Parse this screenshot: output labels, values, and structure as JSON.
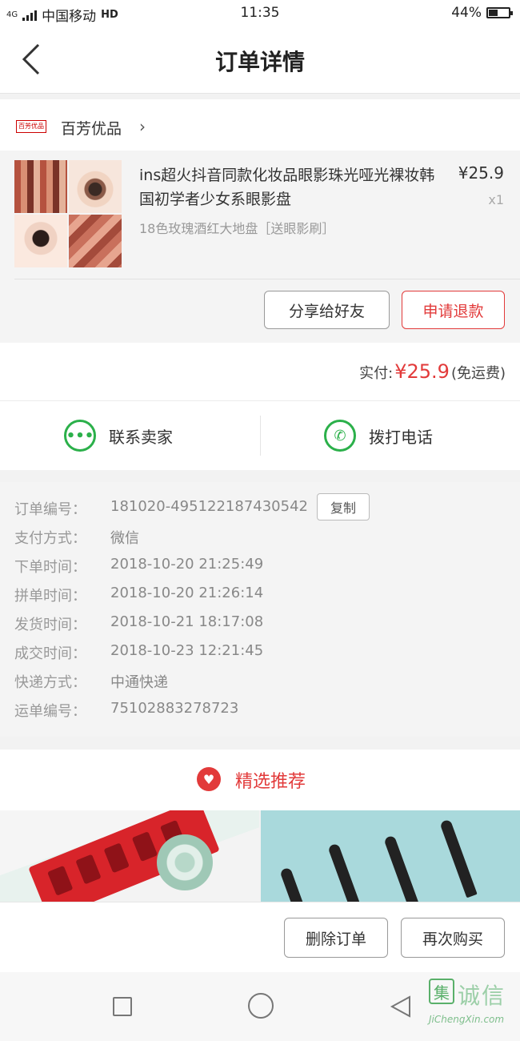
{
  "status_bar": {
    "network": "4G",
    "carrier": "中国移动",
    "hd": "HD",
    "time": "11:35",
    "battery": "44%",
    "battery_level": 0.44
  },
  "header": {
    "title": "订单详情"
  },
  "shop": {
    "logo_text": "百芳优品",
    "name": "百芳优品",
    "chevron": "›"
  },
  "product": {
    "name": "ins超火抖音同款化妆品眼影珠光哑光裸妆韩国初学者少女系眼影盘",
    "spec": "18色玫瑰酒红大地盘［送眼影刷］",
    "price": "¥25.9",
    "quantity": "x1",
    "share_label": "分享给好友",
    "refund_label": "申请退款"
  },
  "total": {
    "label": "实付:",
    "amount": "¥25.9",
    "note": "(免运费)"
  },
  "contact": {
    "seller_label": "联系卖家",
    "phone_label": "拨打电话"
  },
  "order_info": {
    "copy_label": "复制",
    "rows": [
      {
        "key": "订单编号：",
        "value": "181020-495122187430542"
      },
      {
        "key": "支付方式：",
        "value": "微信"
      },
      {
        "key": "下单时间：",
        "value": "2018-10-20 21:25:49"
      },
      {
        "key": "拼单时间：",
        "value": "2018-10-20 21:26:14"
      },
      {
        "key": "发货时间：",
        "value": "2018-10-21 18:17:08"
      },
      {
        "key": "成交时间：",
        "value": "2018-10-23 12:21:45"
      },
      {
        "key": "快递方式：",
        "value": "中通快递"
      },
      {
        "key": "运单编号：",
        "value": "75102883278723"
      }
    ]
  },
  "recommend": {
    "title": "精选推荐"
  },
  "bottom": {
    "delete_label": "删除订单",
    "rebuy_label": "再次购买"
  },
  "watermark": {
    "cn": "诚信",
    "logo": "集",
    "en": "JiChengXin.com"
  },
  "colors": {
    "accent": "#e23a3a",
    "green": "#2bb04a"
  }
}
